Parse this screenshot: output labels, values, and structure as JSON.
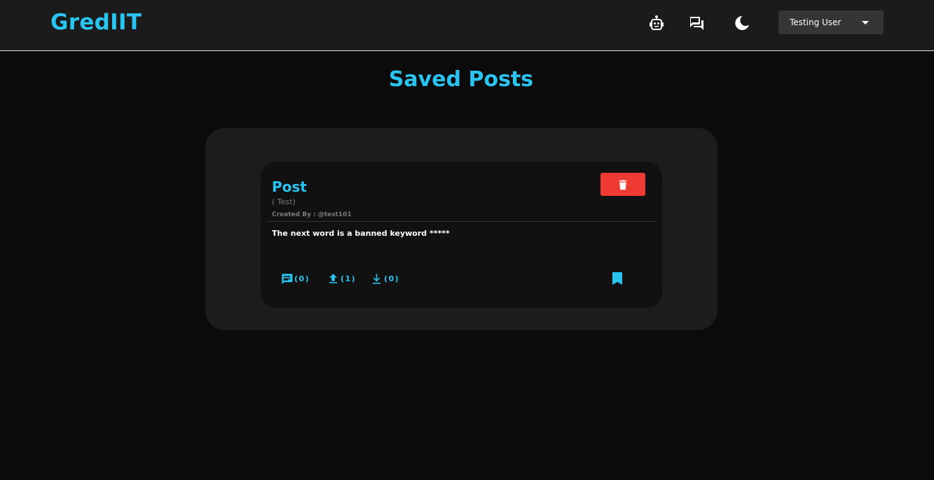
{
  "header": {
    "brand": "GredIIT",
    "user_name": "Testing User"
  },
  "icons": {
    "bot": "robot-icon",
    "chat": "forum-icon",
    "theme": "dark-mode-moon-icon",
    "dropdown": "chevron-down-icon",
    "delete": "trash-icon",
    "comments": "comment-icon",
    "upvote": "upload-arrow-icon",
    "downvote": "download-arrow-icon",
    "saved": "bookmark-icon"
  },
  "colors": {
    "accent": "#29c4ef",
    "danger": "#ee3a32",
    "background": "#0b0b0b",
    "header": "#1b1b1b"
  },
  "main": {
    "title": "Saved Posts",
    "posts": [
      {
        "title": "Post",
        "tag": "( Test)",
        "author": "Created By : @test101",
        "body": "The next word is a banned keyword *****",
        "comments": "(0)",
        "upvotes": "(1)",
        "downvotes": "(0)"
      }
    ]
  }
}
